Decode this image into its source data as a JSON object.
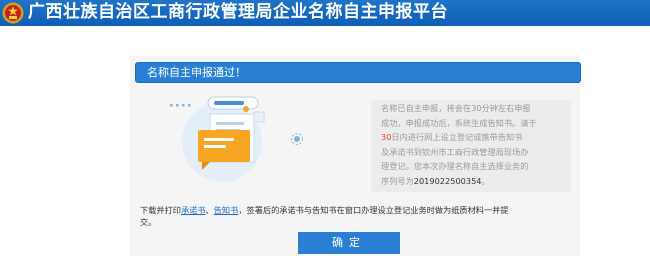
{
  "header": {
    "title": "广西壮族自治区工商行政管理局企业名称自主申报平台",
    "emblem_icon": "national-emblem-icon"
  },
  "panel": {
    "title": "名称自主申报通过！",
    "info": {
      "line1": "名称已自主申报，将会在30分钟左右申报",
      "line2": "成功，申报成功后，系统生成告知书。请于",
      "line3_days": "30",
      "line3_before": "",
      "line3_after": "日内进行网上设立登记或携带告知书",
      "line4": "及承诺书到钦州市工商行政管理局现场办",
      "line5": "理登记。您本次办理名称自主选择业务的",
      "line6_label": "序列号为",
      "serial": "2019022500354",
      "line6_end": "。"
    },
    "note": {
      "prefix": "下载并打印",
      "link1": "承诺书",
      "sep": "、",
      "link2": "告知书",
      "suffix": "，签署后的承诺书与告知书在窗口办理设立登记业务时做为纸质材料一并提",
      "suffix2": "交。"
    },
    "confirm_label": "确定"
  },
  "colors": {
    "header_bg": "#1565c0",
    "accent": "#2a7fd4",
    "highlight": "#e03b2a"
  }
}
